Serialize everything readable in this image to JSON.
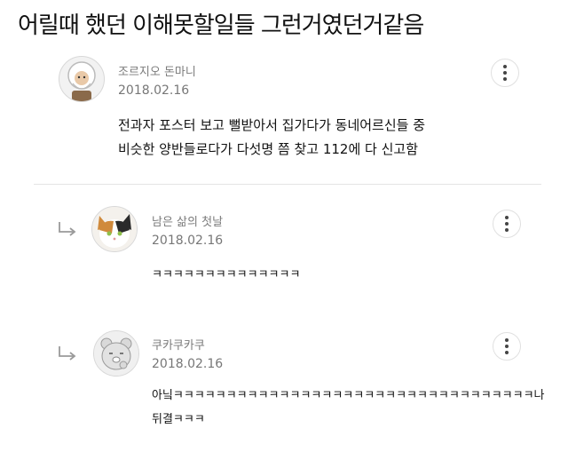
{
  "post": {
    "title": "어릴때 했던 이해못할일들 그런거였던거같음"
  },
  "comments": [
    {
      "nickname": "조르지오 돈마니",
      "date": "2018.02.16",
      "lines": [
        "전과자 포스터 보고 뻘받아서 집가다가 동네어르신들 중",
        "비슷한 양반들로다가 다섯명 쯤 찾고 112에 다 신고함"
      ],
      "avatar_icon": "bearded-character-avatar",
      "more_icon": "more-vertical-icon"
    },
    {
      "nickname": "남은 삶의 첫날",
      "date": "2018.02.16",
      "lines": [
        "ㅋㅋㅋㅋㅋㅋㅋㅋㅋㅋㅋㅋㅋㅋ"
      ],
      "avatar_icon": "calico-cat-avatar",
      "more_icon": "more-vertical-icon",
      "is_reply": true
    },
    {
      "nickname": "쿠카쿠카쿠",
      "date": "2018.02.16",
      "lines": [
        "아닠ㅋㅋㅋㅋㅋㅋㅋㅋㅋㅋㅋㅋㅋㅋㅋㅋㅋㅋㅋㅋㅋㅋㅋㅋㅋㅋㅋㅋㅋㅋㅋㅋㅋㅋ나",
        "뒤결ㅋㅋㅋ"
      ],
      "avatar_icon": "bear-avatar",
      "more_icon": "more-vertical-icon",
      "is_reply": true
    }
  ]
}
